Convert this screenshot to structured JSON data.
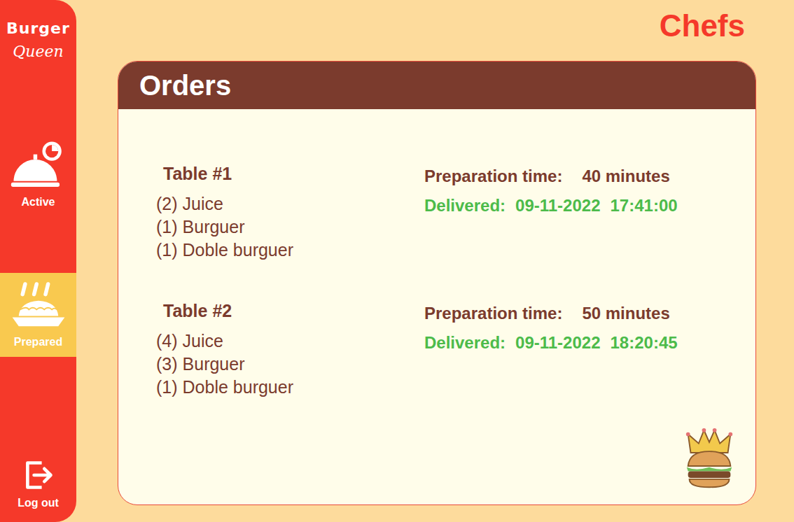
{
  "brand": {
    "line1": "Burger",
    "line2": "Queen"
  },
  "sidebar": {
    "items": [
      {
        "label": "Active",
        "kind": "active",
        "selected": false
      },
      {
        "label": "Prepared",
        "kind": "prepared",
        "selected": true
      }
    ],
    "logout": "Log out"
  },
  "header": {
    "role": "Chefs"
  },
  "panel": {
    "title": "Orders"
  },
  "orders": [
    {
      "table": "Table #1",
      "items": [
        {
          "qty": "(2)",
          "name": "Juice"
        },
        {
          "qty": "(1)",
          "name": "Burguer"
        },
        {
          "qty": "(1)",
          "name": "Doble burguer"
        }
      ],
      "prep_label": "Preparation time:",
      "prep_time": "40 minutes",
      "delivered_label": "Delivered:",
      "date": "09-11-2022",
      "time": "17:41:00"
    },
    {
      "table": "Table #2",
      "items": [
        {
          "qty": "(4)",
          "name": "Juice"
        },
        {
          "qty": "(3)",
          "name": "Burguer"
        },
        {
          "qty": "(1)",
          "name": "Doble burguer"
        }
      ],
      "prep_label": "Preparation time:",
      "prep_time": "50 minutes",
      "delivered_label": "Delivered:",
      "date": "09-11-2022",
      "time": "18:20:45"
    }
  ]
}
